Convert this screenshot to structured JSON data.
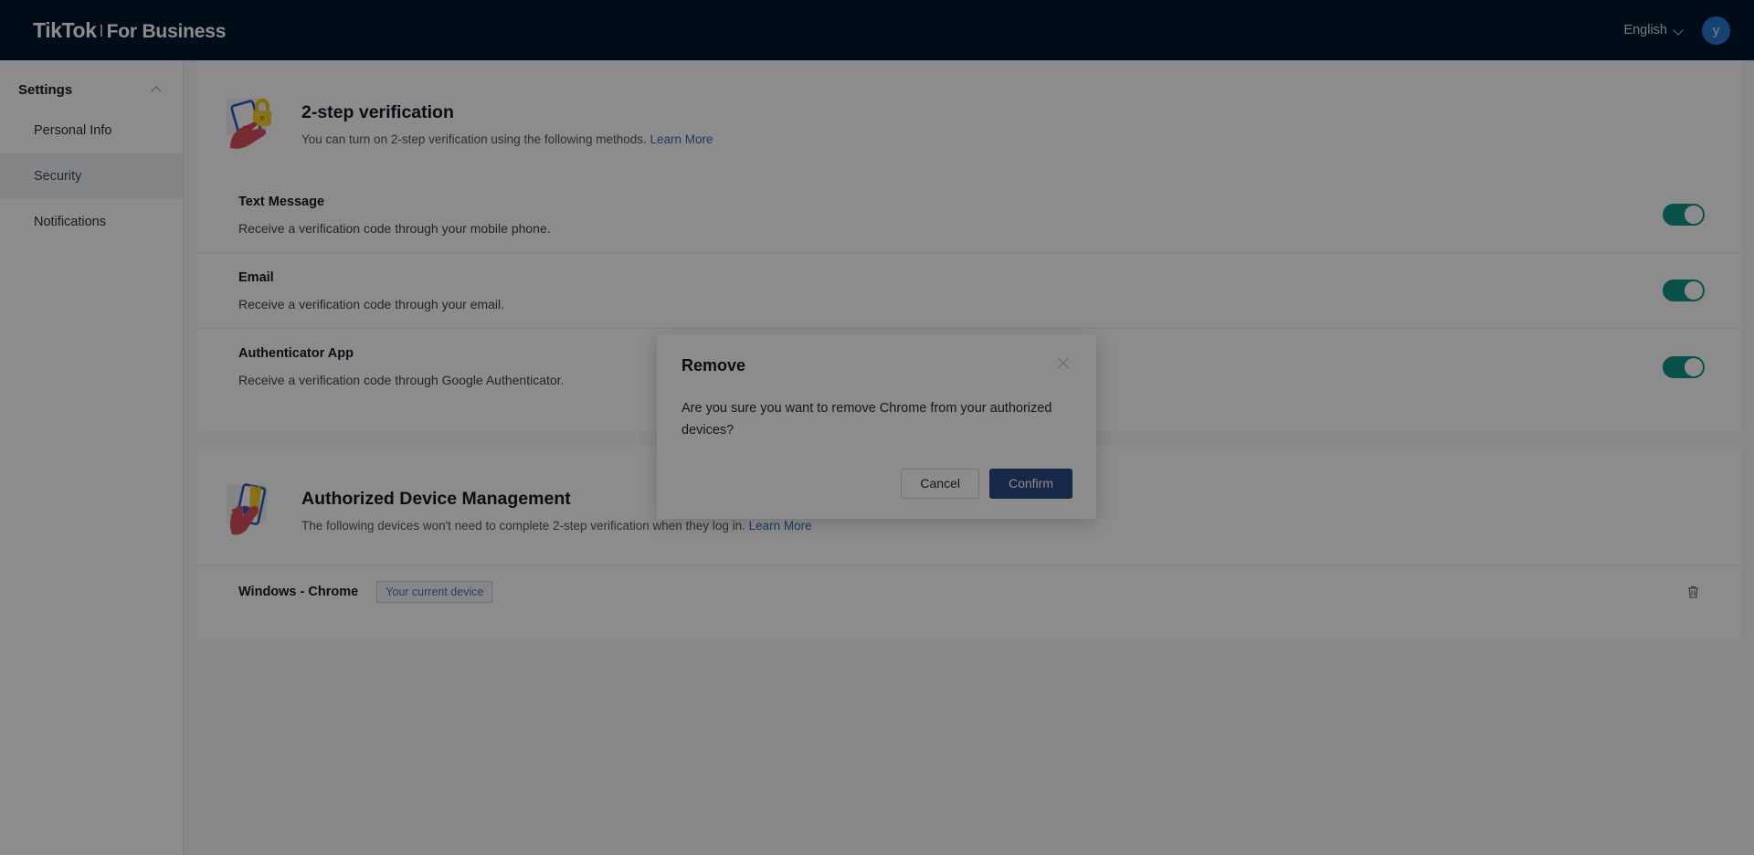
{
  "header": {
    "brand_tiktok": "TikTok",
    "brand_for_business": "For Business",
    "language": "English",
    "language_icon": "chevron-down-icon",
    "avatar_initial": "y",
    "avatar_color": "#2878d0",
    "background_color": "#00182e"
  },
  "sidebar": {
    "title": "Settings",
    "collapse_icon": "chevron-up-icon",
    "items": [
      {
        "label": "Personal Info",
        "active": false
      },
      {
        "label": "Security",
        "active": true
      },
      {
        "label": "Notifications",
        "active": false
      }
    ]
  },
  "two_step": {
    "icon": "phone-lock-hand-icon",
    "title": "2-step verification",
    "description": "You can turn on 2-step verification using the following methods.",
    "learn_more": "Learn More",
    "methods": [
      {
        "name": "Text Message",
        "description": "Receive a verification code through your mobile phone.",
        "toggle_on": true
      },
      {
        "name": "Email",
        "description": "Receive a verification code through your email.",
        "toggle_on": true
      },
      {
        "name": "Authenticator App",
        "description": "Receive a verification code through Google Authenticator.",
        "toggle_on": true
      }
    ]
  },
  "devices": {
    "icon": "hand-phone-icon",
    "title": "Authorized Device Management",
    "description": "The following devices won't need to complete 2-step verification when they log in.",
    "learn_more": "Learn More",
    "rows": [
      {
        "name": "Windows - Chrome",
        "badge": "Your current device",
        "delete_icon": "trash-icon"
      }
    ]
  },
  "modal": {
    "title": "Remove",
    "close_icon": "close-icon",
    "message": "Are you sure you want to remove Chrome from your authorized devices?",
    "cancel_label": "Cancel",
    "confirm_label": "Confirm",
    "confirm_color": "#2a4781"
  },
  "colors": {
    "toggle_on": "#0d9488",
    "link": "#3a68b5",
    "page_bg": "#f7f8fa"
  }
}
